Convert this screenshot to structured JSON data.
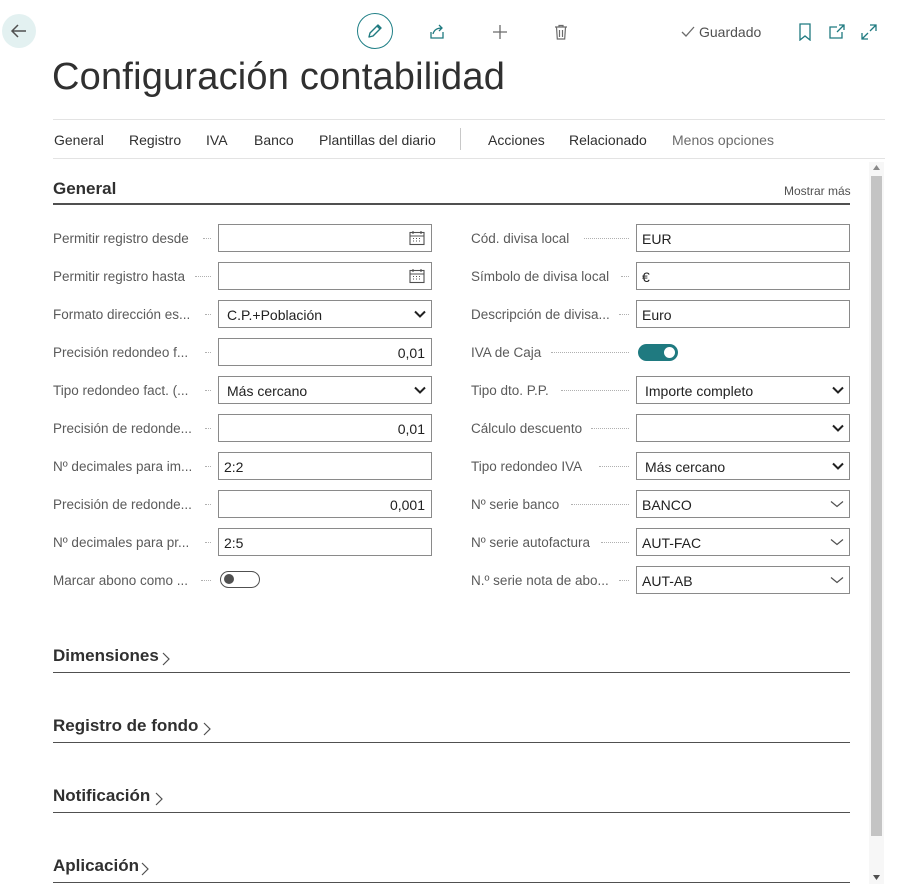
{
  "toolbar": {
    "back_icon": "arrow-left-icon",
    "edit_icon": "pencil-icon",
    "share_icon": "share-icon",
    "new_icon": "plus-icon",
    "delete_icon": "trash-icon",
    "saved_label": "Guardado",
    "bookmark_icon": "bookmark-icon",
    "open_new_icon": "open-new-window-icon",
    "expand_icon": "expand-icon"
  },
  "page": {
    "title": "Configuración contabilidad"
  },
  "nav": {
    "items": [
      "General",
      "Registro",
      "IVA",
      "Banco",
      "Plantillas del diario"
    ],
    "actions": [
      "Acciones",
      "Relacionado",
      "Menos opciones"
    ]
  },
  "general": {
    "title": "General",
    "show_more": "Mostrar más",
    "left": [
      {
        "label": "Permitir registro desde",
        "value": "",
        "type": "date"
      },
      {
        "label": "Permitir registro hasta",
        "value": "",
        "type": "date"
      },
      {
        "label": "Formato dirección es...",
        "value": "C.P.+Población",
        "type": "select"
      },
      {
        "label": "Precisión redondeo f...",
        "value": "0,01",
        "type": "number"
      },
      {
        "label": "Tipo redondeo fact. (...",
        "value": "Más cercano",
        "type": "select"
      },
      {
        "label": "Precisión de redonde...",
        "value": "0,01",
        "type": "number"
      },
      {
        "label": "Nº decimales para im...",
        "value": "2:2",
        "type": "text"
      },
      {
        "label": "Precisión de redonde...",
        "value": "0,001",
        "type": "number"
      },
      {
        "label": "Nº decimales para pr...",
        "value": "2:5",
        "type": "text"
      },
      {
        "label": "Marcar abono como ...",
        "value": "off",
        "type": "toggle"
      }
    ],
    "right": [
      {
        "label": "Cód. divisa local",
        "value": "EUR",
        "type": "text"
      },
      {
        "label": "Símbolo de divisa local",
        "value": "€",
        "type": "text"
      },
      {
        "label": "Descripción de divisa...",
        "value": "Euro",
        "type": "text"
      },
      {
        "label": "IVA de Caja",
        "value": "on",
        "type": "toggle"
      },
      {
        "label": "Tipo dto. P.P.",
        "value": "Importe completo",
        "type": "select"
      },
      {
        "label": "Cálculo descuento",
        "value": "",
        "type": "select"
      },
      {
        "label": "Tipo redondeo IVA",
        "value": "Más cercano",
        "type": "select"
      },
      {
        "label": "Nº serie banco",
        "value": "BANCO",
        "type": "lookup"
      },
      {
        "label": "Nº serie autofactura",
        "value": "AUT-FAC",
        "type": "lookup"
      },
      {
        "label": "N.º serie nota de abo...",
        "value": "AUT-AB",
        "type": "lookup"
      }
    ]
  },
  "sections": [
    "Dimensiones",
    "Registro de fondo",
    "Notificación",
    "Aplicación"
  ],
  "colors": {
    "accent": "#1f7a80",
    "accent_light": "#e3f1f1"
  }
}
